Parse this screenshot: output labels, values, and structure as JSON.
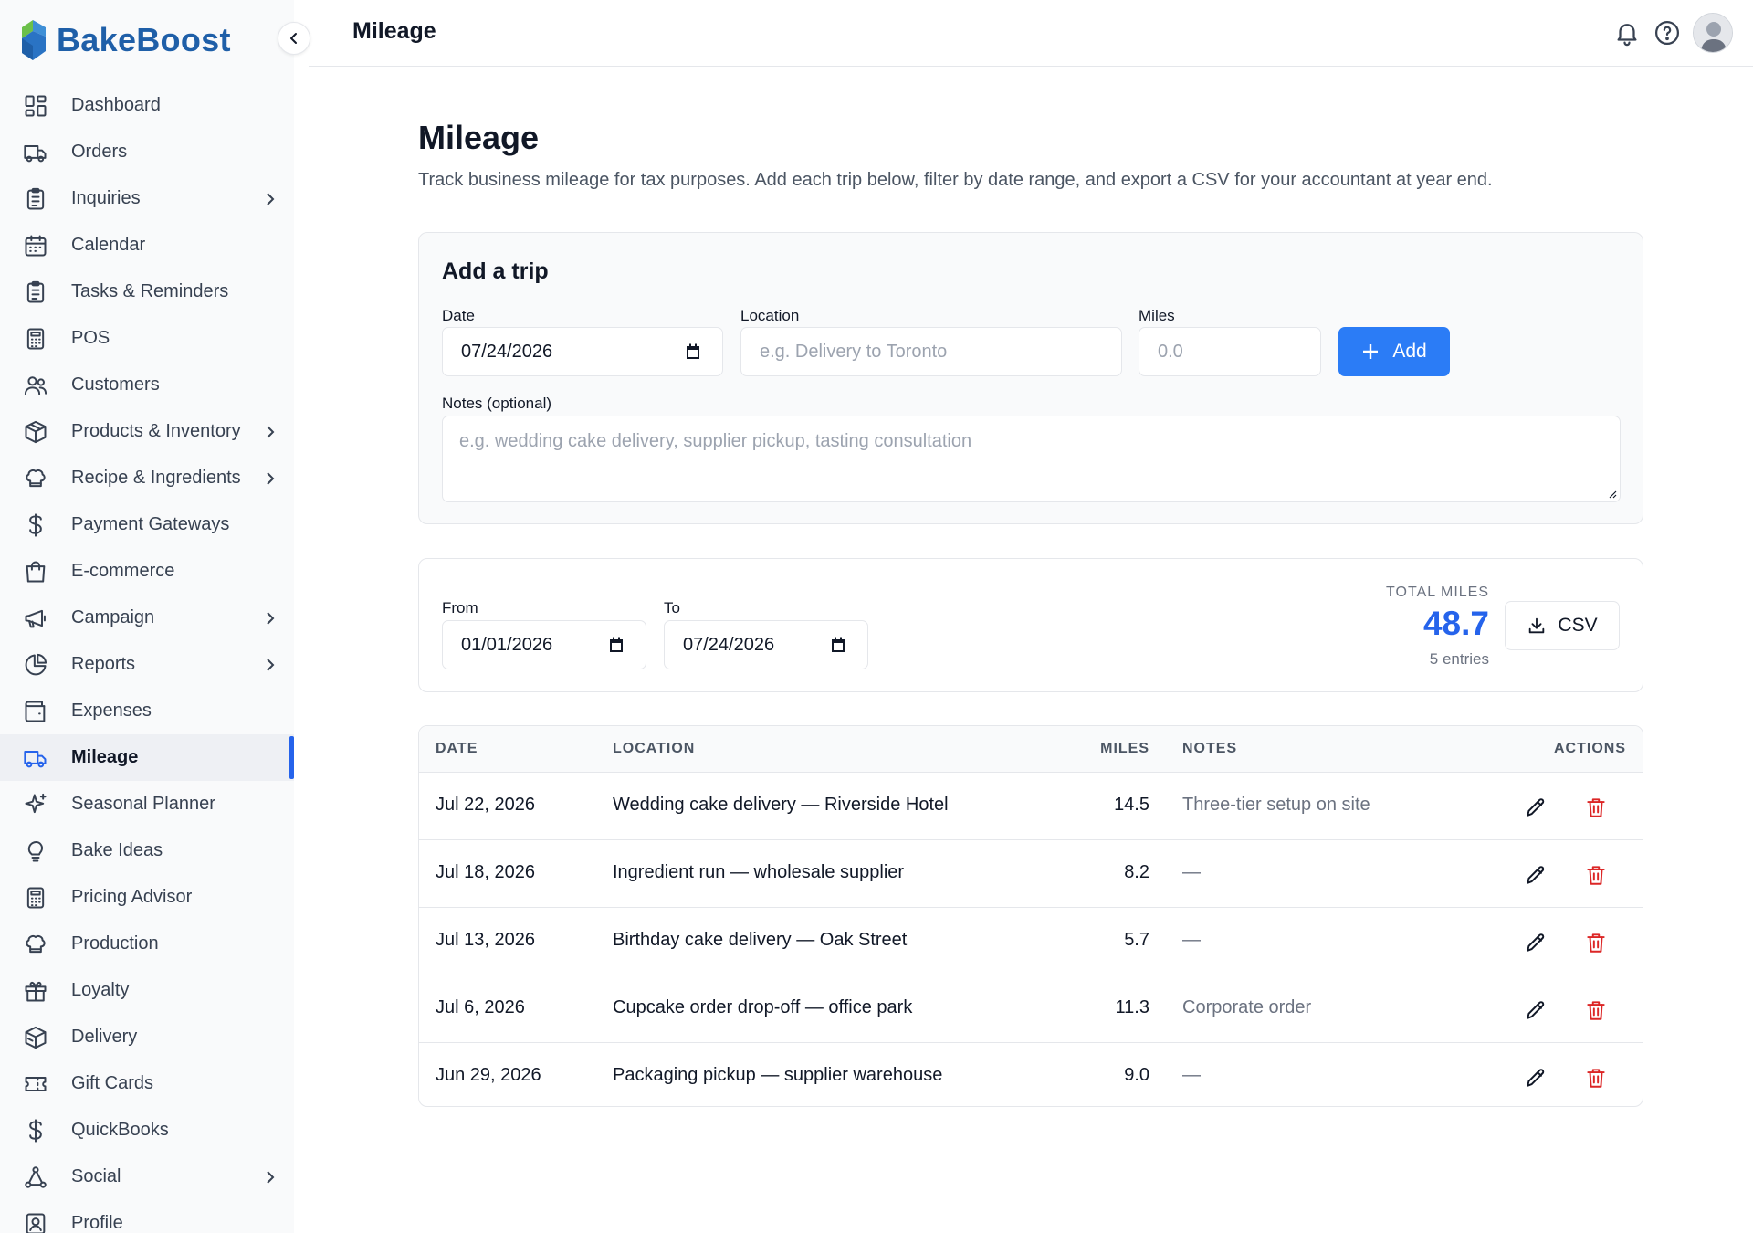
{
  "brand": {
    "name": "BakeBoost"
  },
  "sidebar": {
    "items": [
      {
        "label": "Dashboard",
        "icon": "dashboard-icon",
        "chevron": false,
        "active": false
      },
      {
        "label": "Orders",
        "icon": "truck-icon",
        "chevron": false,
        "active": false
      },
      {
        "label": "Inquiries",
        "icon": "clipboard-icon",
        "chevron": true,
        "active": false
      },
      {
        "label": "Calendar",
        "icon": "calendar-icon",
        "chevron": false,
        "active": false
      },
      {
        "label": "Tasks & Reminders",
        "icon": "clipboard-icon",
        "chevron": false,
        "active": false
      },
      {
        "label": "POS",
        "icon": "calculator-icon",
        "chevron": false,
        "active": false
      },
      {
        "label": "Customers",
        "icon": "users-icon",
        "chevron": false,
        "active": false
      },
      {
        "label": "Products & Inventory",
        "icon": "box-icon",
        "chevron": true,
        "active": false
      },
      {
        "label": "Recipe & Ingredients",
        "icon": "chef-hat-icon",
        "chevron": true,
        "active": false
      },
      {
        "label": "Payment Gateways",
        "icon": "dollar-icon",
        "chevron": false,
        "active": false
      },
      {
        "label": "E-commerce",
        "icon": "shopping-bag-icon",
        "chevron": false,
        "active": false
      },
      {
        "label": "Campaign",
        "icon": "megaphone-icon",
        "chevron": true,
        "active": false
      },
      {
        "label": "Reports",
        "icon": "pie-chart-icon",
        "chevron": true,
        "active": false
      },
      {
        "label": "Expenses",
        "icon": "wallet-icon",
        "chevron": false,
        "active": false
      },
      {
        "label": "Mileage",
        "icon": "truck-icon",
        "chevron": false,
        "active": true
      },
      {
        "label": "Seasonal Planner",
        "icon": "sparkles-icon",
        "chevron": false,
        "active": false
      },
      {
        "label": "Bake Ideas",
        "icon": "lightbulb-icon",
        "chevron": false,
        "active": false
      },
      {
        "label": "Pricing Advisor",
        "icon": "calculator-icon",
        "chevron": false,
        "active": false
      },
      {
        "label": "Production",
        "icon": "chef-hat-icon",
        "chevron": false,
        "active": false
      },
      {
        "label": "Loyalty",
        "icon": "gift-icon",
        "chevron": false,
        "active": false
      },
      {
        "label": "Delivery",
        "icon": "package-icon",
        "chevron": false,
        "active": false
      },
      {
        "label": "Gift Cards",
        "icon": "ticket-icon",
        "chevron": false,
        "active": false
      },
      {
        "label": "QuickBooks",
        "icon": "dollar-icon",
        "chevron": false,
        "active": false
      },
      {
        "label": "Social",
        "icon": "share-icon",
        "chevron": true,
        "active": false
      },
      {
        "label": "Profile",
        "icon": "user-card-icon",
        "chevron": false,
        "active": false
      }
    ]
  },
  "header": {
    "title": "Mileage"
  },
  "page": {
    "title": "Mileage",
    "description": "Track business mileage for tax purposes. Add each trip below, filter by date range, and export a CSV for your accountant at year end."
  },
  "add_trip": {
    "heading": "Add a trip",
    "date_label": "Date",
    "date_value": "07/24/2026",
    "location_label": "Location",
    "location_placeholder": "e.g. Delivery to Toronto",
    "miles_label": "Miles",
    "miles_placeholder": "0.0",
    "add_label": "Add",
    "notes_label": "Notes (optional)",
    "notes_placeholder": "e.g. wedding cake delivery, supplier pickup, tasting consultation"
  },
  "filter": {
    "from_label": "From",
    "from_value": "01/01/2026",
    "to_label": "To",
    "to_value": "07/24/2026",
    "total_label": "TOTAL MILES",
    "total_value": "48.7",
    "entries_text": "5 entries",
    "csv_label": "CSV"
  },
  "table": {
    "headers": {
      "date": "DATE",
      "location": "LOCATION",
      "miles": "MILES",
      "notes": "NOTES",
      "actions": "ACTIONS"
    },
    "rows": [
      {
        "date": "Jul 22, 2026",
        "location": "Wedding cake delivery — Riverside Hotel",
        "miles": "14.5",
        "notes": "Three-tier setup on site"
      },
      {
        "date": "Jul 18, 2026",
        "location": "Ingredient run — wholesale supplier",
        "miles": "8.2",
        "notes": "—"
      },
      {
        "date": "Jul 13, 2026",
        "location": "Birthday cake delivery — Oak Street",
        "miles": "5.7",
        "notes": "—"
      },
      {
        "date": "Jul 6, 2026",
        "location": "Cupcake order drop-off — office park",
        "miles": "11.3",
        "notes": "Corporate order"
      },
      {
        "date": "Jun 29, 2026",
        "location": "Packaging pickup — supplier warehouse",
        "miles": "9.0",
        "notes": "—"
      }
    ]
  },
  "colors": {
    "accent": "#2563eb",
    "add_button": "#2b7cf6",
    "brand": "#1f5fa8",
    "danger": "#dc2626"
  }
}
